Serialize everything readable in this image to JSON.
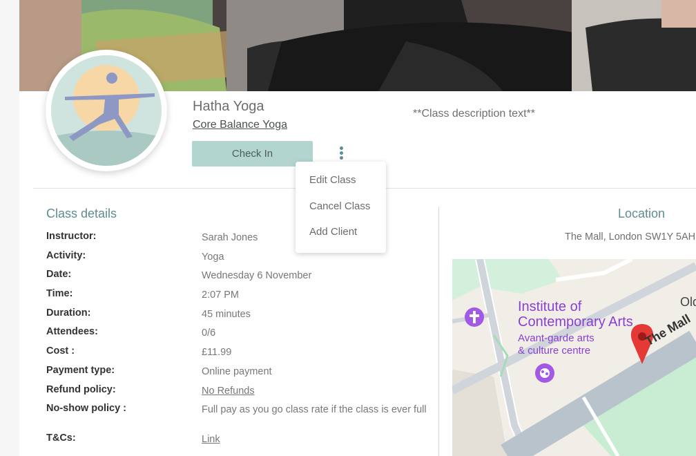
{
  "class": {
    "title": "Hatha Yoga",
    "studio": "Core Balance Yoga",
    "description": "**Class description text**",
    "checkin_label": "Check In"
  },
  "menu": {
    "items": [
      {
        "label": "Edit Class"
      },
      {
        "label": "Cancel Class"
      },
      {
        "label": "Add Client"
      }
    ]
  },
  "details": {
    "section_title": "Class details",
    "rows": [
      {
        "key": "Instructor:",
        "value": "Sarah Jones"
      },
      {
        "key": "Activity:",
        "value": "Yoga"
      },
      {
        "key": "Date:",
        "value": "Wednesday 6 November"
      },
      {
        "key": "Time:",
        "value": "2:07 PM"
      },
      {
        "key": "Duration:",
        "value": "45 minutes"
      },
      {
        "key": "Attendees:",
        "value": "0/6"
      },
      {
        "key": "Cost :",
        "value": "£11.99"
      },
      {
        "key": "Payment type:",
        "value": "Online payment"
      },
      {
        "key": "Refund policy:",
        "value": "No Refunds"
      },
      {
        "key": "No-show policy :",
        "value": "Full pay as you go class rate if the class is ever full"
      },
      {
        "key": "T&Cs:",
        "value": "Link"
      }
    ]
  },
  "location": {
    "title": "Location",
    "address": "The Mall, London SW1Y 5AH",
    "map_labels": {
      "ica_line1": "Institute of",
      "ica_line2": "Contemporary Arts",
      "ica_sub1": "Avant-garde arts",
      "ica_sub2": "& culture centre",
      "street": "The Mall",
      "partial": "Old"
    }
  },
  "colors": {
    "accent": "#5e8c91",
    "button": "#b3d5d0",
    "map_pin": "#e53935",
    "poi": "#a259e6"
  }
}
